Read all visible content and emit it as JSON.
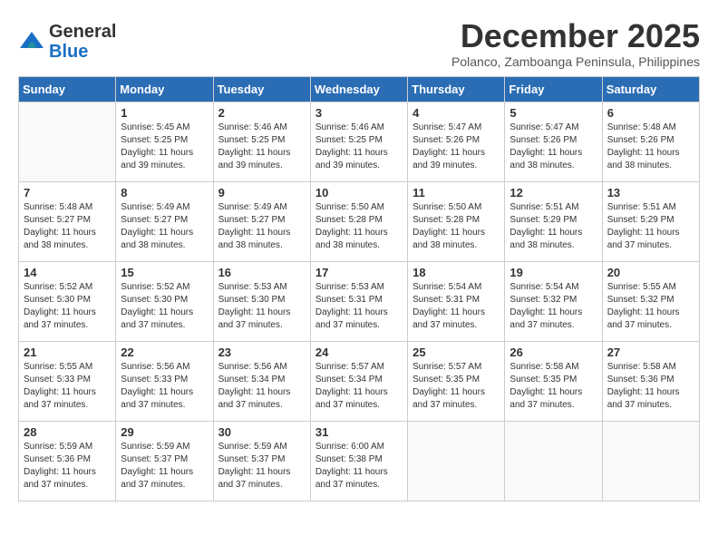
{
  "logo": {
    "general": "General",
    "blue": "Blue"
  },
  "title": "December 2025",
  "location": "Polanco, Zamboanga Peninsula, Philippines",
  "days_of_week": [
    "Sunday",
    "Monday",
    "Tuesday",
    "Wednesday",
    "Thursday",
    "Friday",
    "Saturday"
  ],
  "weeks": [
    [
      {
        "day": "",
        "sunrise": "",
        "sunset": "",
        "daylight": ""
      },
      {
        "day": "1",
        "sunrise": "Sunrise: 5:45 AM",
        "sunset": "Sunset: 5:25 PM",
        "daylight": "Daylight: 11 hours and 39 minutes."
      },
      {
        "day": "2",
        "sunrise": "Sunrise: 5:46 AM",
        "sunset": "Sunset: 5:25 PM",
        "daylight": "Daylight: 11 hours and 39 minutes."
      },
      {
        "day": "3",
        "sunrise": "Sunrise: 5:46 AM",
        "sunset": "Sunset: 5:25 PM",
        "daylight": "Daylight: 11 hours and 39 minutes."
      },
      {
        "day": "4",
        "sunrise": "Sunrise: 5:47 AM",
        "sunset": "Sunset: 5:26 PM",
        "daylight": "Daylight: 11 hours and 39 minutes."
      },
      {
        "day": "5",
        "sunrise": "Sunrise: 5:47 AM",
        "sunset": "Sunset: 5:26 PM",
        "daylight": "Daylight: 11 hours and 38 minutes."
      },
      {
        "day": "6",
        "sunrise": "Sunrise: 5:48 AM",
        "sunset": "Sunset: 5:26 PM",
        "daylight": "Daylight: 11 hours and 38 minutes."
      }
    ],
    [
      {
        "day": "7",
        "sunrise": "Sunrise: 5:48 AM",
        "sunset": "Sunset: 5:27 PM",
        "daylight": "Daylight: 11 hours and 38 minutes."
      },
      {
        "day": "8",
        "sunrise": "Sunrise: 5:49 AM",
        "sunset": "Sunset: 5:27 PM",
        "daylight": "Daylight: 11 hours and 38 minutes."
      },
      {
        "day": "9",
        "sunrise": "Sunrise: 5:49 AM",
        "sunset": "Sunset: 5:27 PM",
        "daylight": "Daylight: 11 hours and 38 minutes."
      },
      {
        "day": "10",
        "sunrise": "Sunrise: 5:50 AM",
        "sunset": "Sunset: 5:28 PM",
        "daylight": "Daylight: 11 hours and 38 minutes."
      },
      {
        "day": "11",
        "sunrise": "Sunrise: 5:50 AM",
        "sunset": "Sunset: 5:28 PM",
        "daylight": "Daylight: 11 hours and 38 minutes."
      },
      {
        "day": "12",
        "sunrise": "Sunrise: 5:51 AM",
        "sunset": "Sunset: 5:29 PM",
        "daylight": "Daylight: 11 hours and 38 minutes."
      },
      {
        "day": "13",
        "sunrise": "Sunrise: 5:51 AM",
        "sunset": "Sunset: 5:29 PM",
        "daylight": "Daylight: 11 hours and 37 minutes."
      }
    ],
    [
      {
        "day": "14",
        "sunrise": "Sunrise: 5:52 AM",
        "sunset": "Sunset: 5:30 PM",
        "daylight": "Daylight: 11 hours and 37 minutes."
      },
      {
        "day": "15",
        "sunrise": "Sunrise: 5:52 AM",
        "sunset": "Sunset: 5:30 PM",
        "daylight": "Daylight: 11 hours and 37 minutes."
      },
      {
        "day": "16",
        "sunrise": "Sunrise: 5:53 AM",
        "sunset": "Sunset: 5:30 PM",
        "daylight": "Daylight: 11 hours and 37 minutes."
      },
      {
        "day": "17",
        "sunrise": "Sunrise: 5:53 AM",
        "sunset": "Sunset: 5:31 PM",
        "daylight": "Daylight: 11 hours and 37 minutes."
      },
      {
        "day": "18",
        "sunrise": "Sunrise: 5:54 AM",
        "sunset": "Sunset: 5:31 PM",
        "daylight": "Daylight: 11 hours and 37 minutes."
      },
      {
        "day": "19",
        "sunrise": "Sunrise: 5:54 AM",
        "sunset": "Sunset: 5:32 PM",
        "daylight": "Daylight: 11 hours and 37 minutes."
      },
      {
        "day": "20",
        "sunrise": "Sunrise: 5:55 AM",
        "sunset": "Sunset: 5:32 PM",
        "daylight": "Daylight: 11 hours and 37 minutes."
      }
    ],
    [
      {
        "day": "21",
        "sunrise": "Sunrise: 5:55 AM",
        "sunset": "Sunset: 5:33 PM",
        "daylight": "Daylight: 11 hours and 37 minutes."
      },
      {
        "day": "22",
        "sunrise": "Sunrise: 5:56 AM",
        "sunset": "Sunset: 5:33 PM",
        "daylight": "Daylight: 11 hours and 37 minutes."
      },
      {
        "day": "23",
        "sunrise": "Sunrise: 5:56 AM",
        "sunset": "Sunset: 5:34 PM",
        "daylight": "Daylight: 11 hours and 37 minutes."
      },
      {
        "day": "24",
        "sunrise": "Sunrise: 5:57 AM",
        "sunset": "Sunset: 5:34 PM",
        "daylight": "Daylight: 11 hours and 37 minutes."
      },
      {
        "day": "25",
        "sunrise": "Sunrise: 5:57 AM",
        "sunset": "Sunset: 5:35 PM",
        "daylight": "Daylight: 11 hours and 37 minutes."
      },
      {
        "day": "26",
        "sunrise": "Sunrise: 5:58 AM",
        "sunset": "Sunset: 5:35 PM",
        "daylight": "Daylight: 11 hours and 37 minutes."
      },
      {
        "day": "27",
        "sunrise": "Sunrise: 5:58 AM",
        "sunset": "Sunset: 5:36 PM",
        "daylight": "Daylight: 11 hours and 37 minutes."
      }
    ],
    [
      {
        "day": "28",
        "sunrise": "Sunrise: 5:59 AM",
        "sunset": "Sunset: 5:36 PM",
        "daylight": "Daylight: 11 hours and 37 minutes."
      },
      {
        "day": "29",
        "sunrise": "Sunrise: 5:59 AM",
        "sunset": "Sunset: 5:37 PM",
        "daylight": "Daylight: 11 hours and 37 minutes."
      },
      {
        "day": "30",
        "sunrise": "Sunrise: 5:59 AM",
        "sunset": "Sunset: 5:37 PM",
        "daylight": "Daylight: 11 hours and 37 minutes."
      },
      {
        "day": "31",
        "sunrise": "Sunrise: 6:00 AM",
        "sunset": "Sunset: 5:38 PM",
        "daylight": "Daylight: 11 hours and 37 minutes."
      },
      {
        "day": "",
        "sunrise": "",
        "sunset": "",
        "daylight": ""
      },
      {
        "day": "",
        "sunrise": "",
        "sunset": "",
        "daylight": ""
      },
      {
        "day": "",
        "sunrise": "",
        "sunset": "",
        "daylight": ""
      }
    ]
  ]
}
